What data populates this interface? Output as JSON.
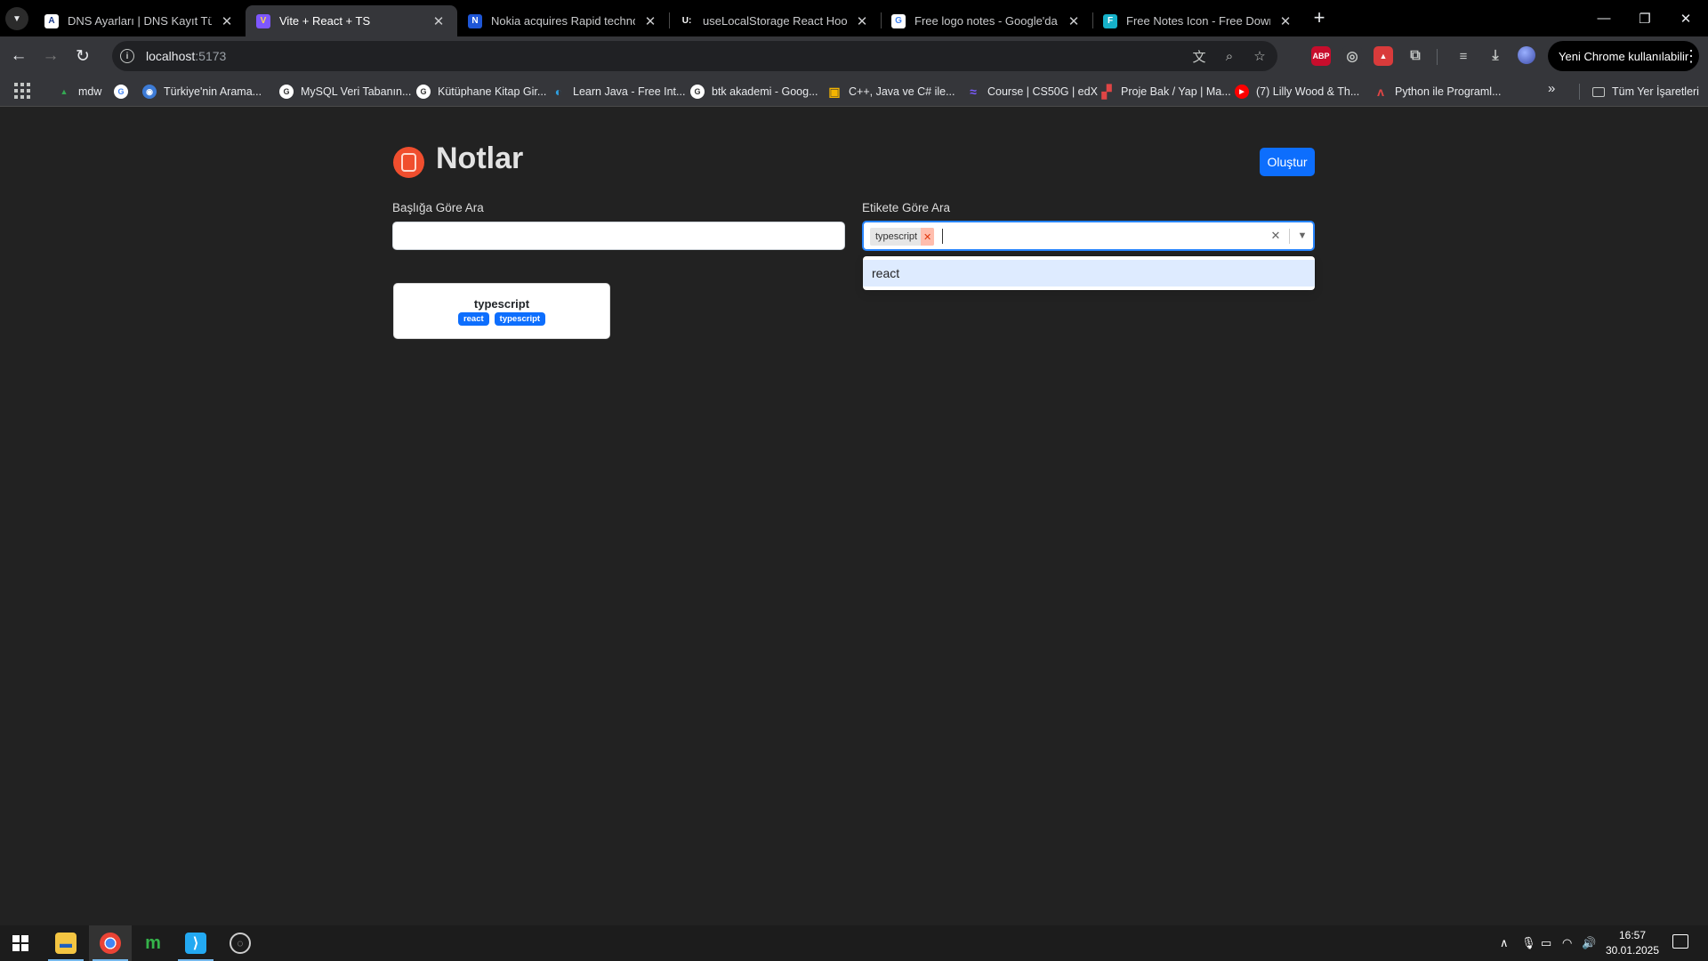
{
  "browser": {
    "tabs": [
      {
        "title": "DNS Ayarları | DNS Kayıt Türleri",
        "favicon": "A",
        "favicon_bg": "#ffffff",
        "favicon_color": "#1a3a8a"
      },
      {
        "title": "Vite + React + TS",
        "favicon": "V",
        "favicon_bg": "#7e57ff",
        "favicon_color": "#ffd54f"
      },
      {
        "title": "Nokia acquires Rapid technology",
        "favicon": "N",
        "favicon_bg": "#1e56d6",
        "favicon_color": "#ffffff"
      },
      {
        "title": "useLocalStorage React Hook – u",
        "favicon": "U:",
        "favicon_bg": "#000000",
        "favicon_color": "#ffffff"
      },
      {
        "title": "Free logo notes - Google'da Ara",
        "favicon": "G",
        "favicon_bg": "#ffffff",
        "favicon_color": "#4285f4"
      },
      {
        "title": "Free Notes Icon - Free Download",
        "favicon": "F",
        "favicon_bg": "#16b1c9",
        "favicon_color": "#ffffff"
      }
    ],
    "address": {
      "host": "localhost",
      "port": ":5173"
    },
    "update_chip": "Yeni Chrome kullanılabilir",
    "extensions": [
      {
        "label": "ABP",
        "bg": "#c70d2c"
      },
      {
        "label": "◎",
        "bg": "#35363a"
      },
      {
        "label": "▲",
        "bg": "#d93b3b"
      }
    ],
    "bookmarks": [
      {
        "label": "mdw",
        "icon": "▲",
        "color": "#34a853"
      },
      {
        "label": "",
        "icon": "G",
        "color": "#ffffff"
      },
      {
        "label": "Türkiye'nin Arama...",
        "icon": "◉",
        "color": "#3d7bd6"
      },
      {
        "label": "MySQL Veri Tabanın...",
        "icon": "G",
        "color": "#ffffff"
      },
      {
        "label": "Kütüphane Kitap Gir...",
        "icon": "G",
        "color": "#ffffff"
      },
      {
        "label": "Learn Java - Free Int...",
        "icon": "◐",
        "color": "#2ea0e0"
      },
      {
        "label": "btk akademi - Goog...",
        "icon": "G",
        "color": "#ffffff"
      },
      {
        "label": "C++, Java ve C# ile...",
        "icon": "▣",
        "color": "#f4b400"
      },
      {
        "label": "Course | CS50G | edX",
        "icon": "≈",
        "color": "#7b5cff"
      },
      {
        "label": "Proje Bak / Yap | Ma...",
        "icon": "▞",
        "color": "#e04545"
      },
      {
        "label": "(7) Lilly Wood & Th...",
        "icon": "▶",
        "color": "#ff0000"
      },
      {
        "label": "Python ile Programl...",
        "icon": "ʌ",
        "color": "#e04545"
      }
    ],
    "all_bookmarks": "Tüm Yer İşaretleri"
  },
  "app": {
    "title": "Notlar",
    "create_button": "Oluştur",
    "title_search_label": "Başlığa Göre Ara",
    "title_search_value": "",
    "tag_search_label": "Etikete Göre Ara",
    "selected_tags": [
      "typescript"
    ],
    "dropdown_options": [
      "react"
    ],
    "notes": [
      {
        "title": "typescript",
        "tags": [
          "react",
          "typescript"
        ]
      }
    ],
    "accent_color": "#0d6efd",
    "logo_color": "#f04e2e"
  },
  "taskbar": {
    "time": "16:57",
    "date": "30.01.2025",
    "apps": [
      {
        "name": "file-explorer",
        "glyph": "▬",
        "color": "#f4c542",
        "open": true,
        "active": false
      },
      {
        "name": "chrome",
        "glyph": "◉",
        "color": "#4285f4",
        "open": true,
        "active": true
      },
      {
        "name": "m-app",
        "glyph": "m",
        "color": "#35b34a",
        "open": false,
        "active": false
      },
      {
        "name": "vscode",
        "glyph": "⟩",
        "color": "#23a9f2",
        "open": true,
        "active": false
      },
      {
        "name": "obs",
        "glyph": "◌",
        "color": "#cccccc",
        "open": false,
        "active": false
      }
    ]
  }
}
